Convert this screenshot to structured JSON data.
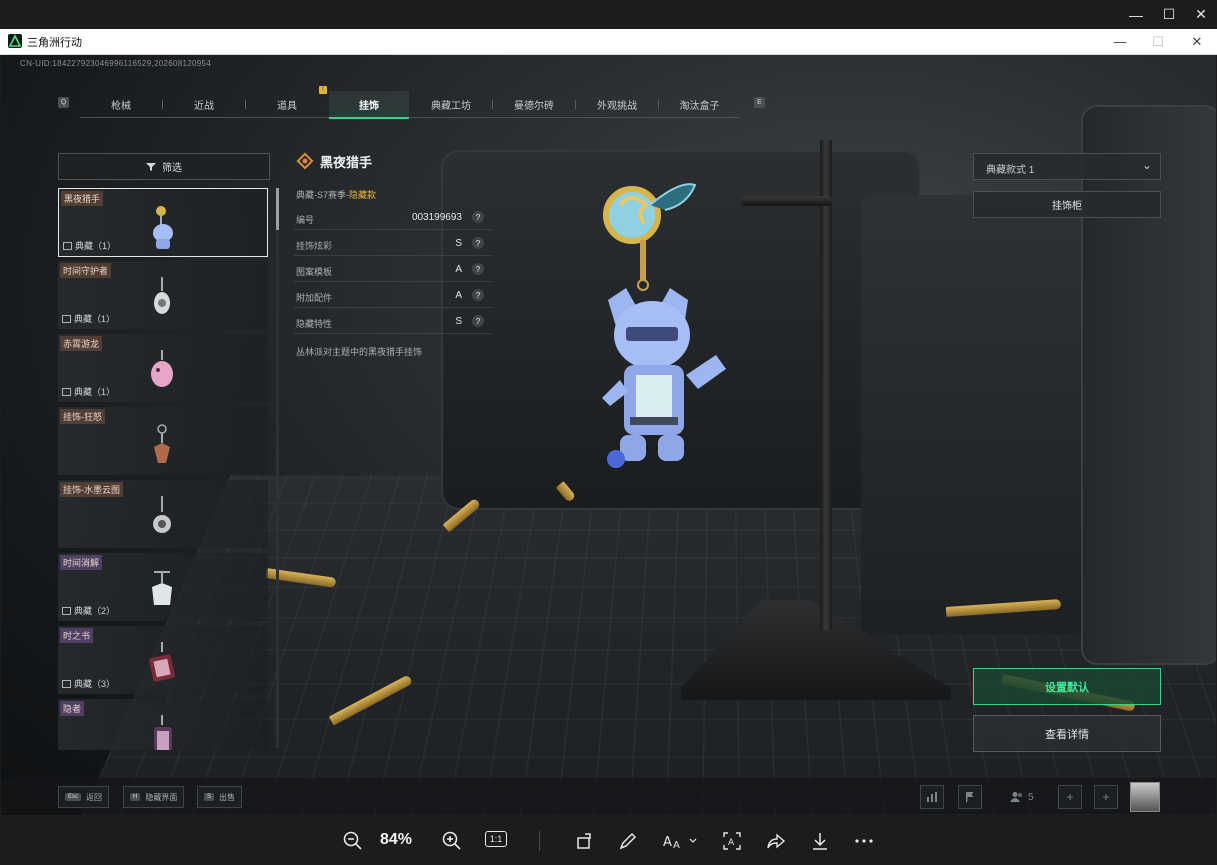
{
  "viewer": {
    "minimize": "—",
    "maximize": "☐",
    "close": "✕",
    "zoom": "84%",
    "ratio_label": "1:1"
  },
  "game_window": {
    "title": "三角洲行动",
    "minimize": "—",
    "maximize": "☐",
    "close": "✕"
  },
  "uid": "CN-UID:184227923046996116529,202608120954",
  "tabs": {
    "left_key": "Q",
    "right_key": "E",
    "badge": "!",
    "items": [
      {
        "label": "枪械"
      },
      {
        "label": "近战"
      },
      {
        "label": "道具"
      },
      {
        "label": "挂饰"
      },
      {
        "label": "典藏工坊"
      },
      {
        "label": "曼德尔砖"
      },
      {
        "label": "外观挑战"
      },
      {
        "label": "淘汰盒子"
      }
    ],
    "active_index": 3
  },
  "filter": {
    "label": "筛选"
  },
  "list": {
    "items": [
      {
        "name": "黑夜猎手",
        "rarity": "典藏（1）",
        "name_color": "brown"
      },
      {
        "name": "时间守护者",
        "rarity": "典藏（1）",
        "name_color": "brown"
      },
      {
        "name": "赤霄游龙",
        "rarity": "典藏（1）",
        "name_color": "brown"
      },
      {
        "name": "挂饰-狂怒",
        "rarity": "",
        "name_color": "brown"
      },
      {
        "name": "挂饰-水墨云图",
        "rarity": "",
        "name_color": "brown"
      },
      {
        "name": "时间消解",
        "rarity": "典藏（2）",
        "name_color": "purple"
      },
      {
        "name": "时之书",
        "rarity": "典藏（3）",
        "name_color": "purple"
      },
      {
        "name": "隐者",
        "rarity": "",
        "name_color": "purple"
      }
    ],
    "selected_index": 0
  },
  "detail": {
    "title": "黑夜猎手",
    "subtitle_prefix": "典藏-S7赛季-",
    "subtitle_highlight": "隐藏款",
    "attributes": [
      {
        "label": "编号",
        "value": "003199693"
      },
      {
        "label": "挂饰炫彩",
        "value": "S"
      },
      {
        "label": "图案模板",
        "value": "A"
      },
      {
        "label": "附加配件",
        "value": "A"
      },
      {
        "label": "隐藏特性",
        "value": "S"
      }
    ],
    "question_mark": "?",
    "description": "丛林派对主题中的黑夜猎手挂饰"
  },
  "right_panel": {
    "style_select": "典藏款式 1",
    "cabinet_button": "挂饰柜",
    "default_button": "设置默认",
    "detail_button": "查看详情"
  },
  "bottom_hints": [
    {
      "key": "Esc",
      "label": "返回"
    },
    {
      "key": "H",
      "label": "隐藏界面"
    },
    {
      "key": "S",
      "label": "出售"
    }
  ],
  "friend_count": "5",
  "colors": {
    "accent_green": "#3ccf8e",
    "highlight_gold": "#e8b83a"
  }
}
